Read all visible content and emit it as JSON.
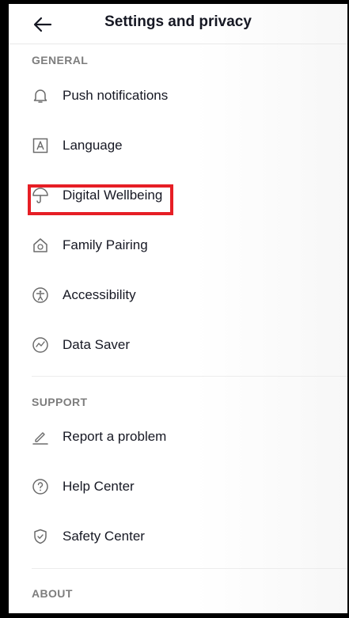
{
  "header": {
    "title": "Settings and privacy",
    "back_icon": "arrow-left-icon"
  },
  "sections": {
    "general": {
      "title": "GENERAL",
      "items": [
        {
          "label": "Push notifications",
          "icon": "bell-icon"
        },
        {
          "label": "Language",
          "icon": "language-icon"
        },
        {
          "label": "Digital Wellbeing",
          "icon": "umbrella-icon",
          "highlighted": true
        },
        {
          "label": "Family Pairing",
          "icon": "family-house-icon"
        },
        {
          "label": "Accessibility",
          "icon": "accessibility-icon"
        },
        {
          "label": "Data Saver",
          "icon": "data-saver-icon"
        }
      ]
    },
    "support": {
      "title": "SUPPORT",
      "items": [
        {
          "label": "Report a problem",
          "icon": "pencil-icon"
        },
        {
          "label": "Help Center",
          "icon": "question-icon"
        },
        {
          "label": "Safety Center",
          "icon": "shield-icon"
        }
      ]
    },
    "about": {
      "title": "ABOUT"
    }
  },
  "colors": {
    "text": "#161823",
    "section": "#7d7d7d",
    "icon": "#6b6b6b",
    "highlight": "#e61e25"
  }
}
